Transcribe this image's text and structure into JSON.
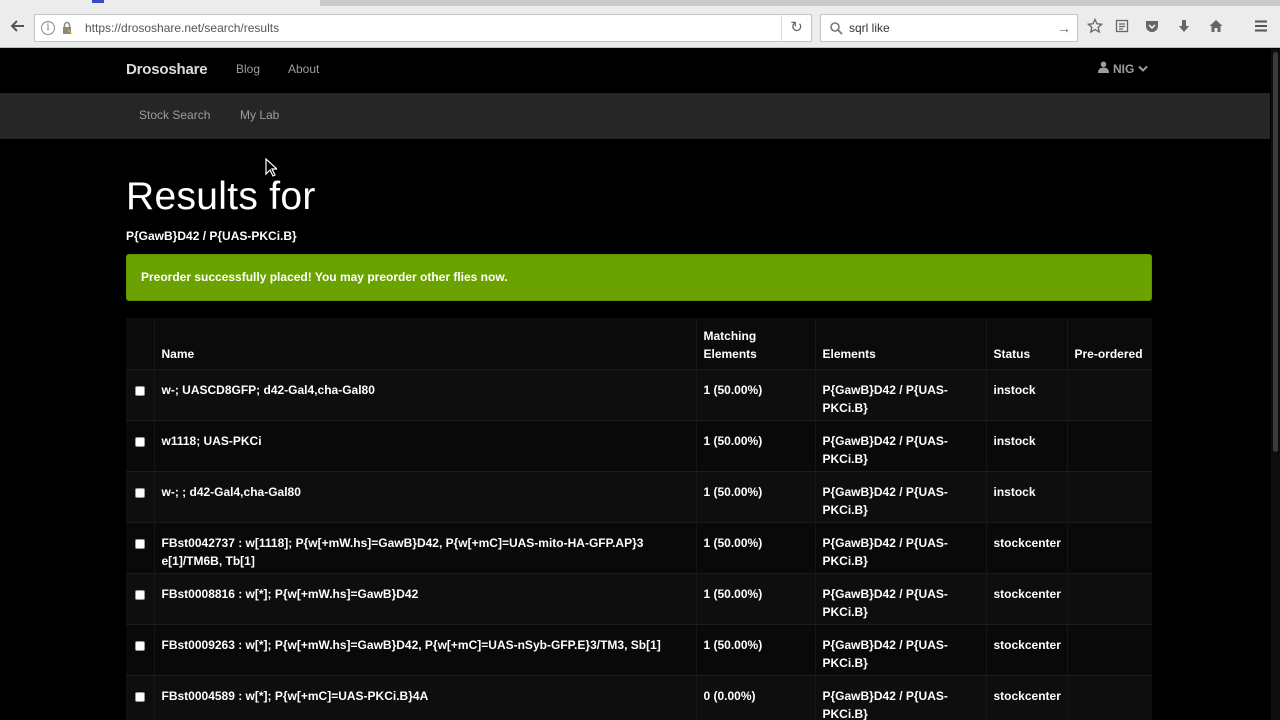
{
  "browser": {
    "url": "https://drososhare.net/search/results",
    "search_value": "sqrl like",
    "icons": [
      "back-icon",
      "info-icon",
      "lock-icon",
      "reload-icon",
      "search-icon",
      "go-icon",
      "bookmark-star-icon",
      "reading-list-icon",
      "pocket-icon",
      "download-icon",
      "home-icon",
      "menu-icon"
    ]
  },
  "navbar": {
    "brand": "Drososhare",
    "links": [
      "Blog",
      "About"
    ],
    "user": "NIG"
  },
  "subnav": {
    "links": [
      "Stock Search",
      "My Lab"
    ]
  },
  "page": {
    "title": "Results for",
    "query": "P{GawB}D42 / P{UAS-PKCi.B}"
  },
  "alert": {
    "message": "Preorder successfully placed! You may preorder other flies now.",
    "color": "#6aa300"
  },
  "table": {
    "headers": {
      "name": "Name",
      "matching_line1": "Matching",
      "matching_line2": "Elements",
      "elements": "Elements",
      "status": "Status",
      "preordered": "Pre-ordered"
    },
    "rows": [
      {
        "name": "w-; UASCD8GFP; d42-Gal4,cha-Gal80",
        "matching": "1 (50.00%)",
        "elements": "P{GawB}D42 / P{UAS-PKCi.B}",
        "status": "instock",
        "preordered": ""
      },
      {
        "name": "w1118; UAS-PKCi",
        "matching": "1 (50.00%)",
        "elements": "P{GawB}D42 / P{UAS-PKCi.B}",
        "status": "instock",
        "preordered": ""
      },
      {
        "name": "w-; ; d42-Gal4,cha-Gal80",
        "matching": "1 (50.00%)",
        "elements": "P{GawB}D42 / P{UAS-PKCi.B}",
        "status": "instock",
        "preordered": ""
      },
      {
        "name": "FBst0042737 : w[1118]; P{w[+mW.hs]=GawB}D42, P{w[+mC]=UAS-mito-HA-GFP.AP}3 e[1]/TM6B, Tb[1]",
        "matching": "1 (50.00%)",
        "elements": "P{GawB}D42 / P{UAS-PKCi.B}",
        "status": "stockcenter",
        "preordered": ""
      },
      {
        "name": "FBst0008816 : w[*]; P{w[+mW.hs]=GawB}D42",
        "matching": "1 (50.00%)",
        "elements": "P{GawB}D42 / P{UAS-PKCi.B}",
        "status": "stockcenter",
        "preordered": ""
      },
      {
        "name": "FBst0009263 : w[*]; P{w[+mW.hs]=GawB}D42, P{w[+mC]=UAS-nSyb-GFP.E}3/TM3, Sb[1]",
        "matching": "1 (50.00%)",
        "elements": "P{GawB}D42 / P{UAS-PKCi.B}",
        "status": "stockcenter",
        "preordered": ""
      },
      {
        "name": "FBst0004589 : w[*]; P{w[+mC]=UAS-PKCi.B}4A",
        "matching": "0 (0.00%)",
        "elements": "P{GawB}D42 / P{UAS-PKCi.B}",
        "status": "stockcenter",
        "preordered": ""
      }
    ]
  }
}
